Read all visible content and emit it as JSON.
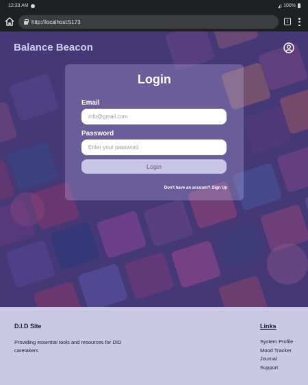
{
  "status_bar": {
    "time": "12:33 AM",
    "battery": "100%"
  },
  "browser": {
    "url": "http://localhost:5173",
    "tab_count": "1"
  },
  "header": {
    "brand": "Balance Beacon"
  },
  "login": {
    "title": "Login",
    "email_label": "Email",
    "email_placeholder": "info@gmail.com",
    "password_label": "Password",
    "password_placeholder": "Enter your password",
    "login_button": "Login",
    "no_account_text": "Don't have an account?",
    "signup_link": "Sign Up"
  },
  "footer": {
    "site_title": "D.I.D Site",
    "description": "Providing essential tools and resources for DID caretakers",
    "links_title": "Links",
    "links": [
      "System Profile",
      "Mood Tracker",
      "Journal",
      "Support"
    ]
  },
  "icons": {
    "status_left": "notification-dot-icon",
    "signal": "signal-icon",
    "battery": "battery-icon",
    "home": "home-icon",
    "lock": "lock-icon",
    "tabs": "tabs-icon",
    "menu": "more-vert-icon",
    "profile": "user-profile-icon"
  },
  "colors": {
    "hero_overlay": "#463a78",
    "brand_text": "#cdd0ee",
    "footer_bg": "#cbc8e6",
    "login_button_bg": "#c8c5e6"
  }
}
